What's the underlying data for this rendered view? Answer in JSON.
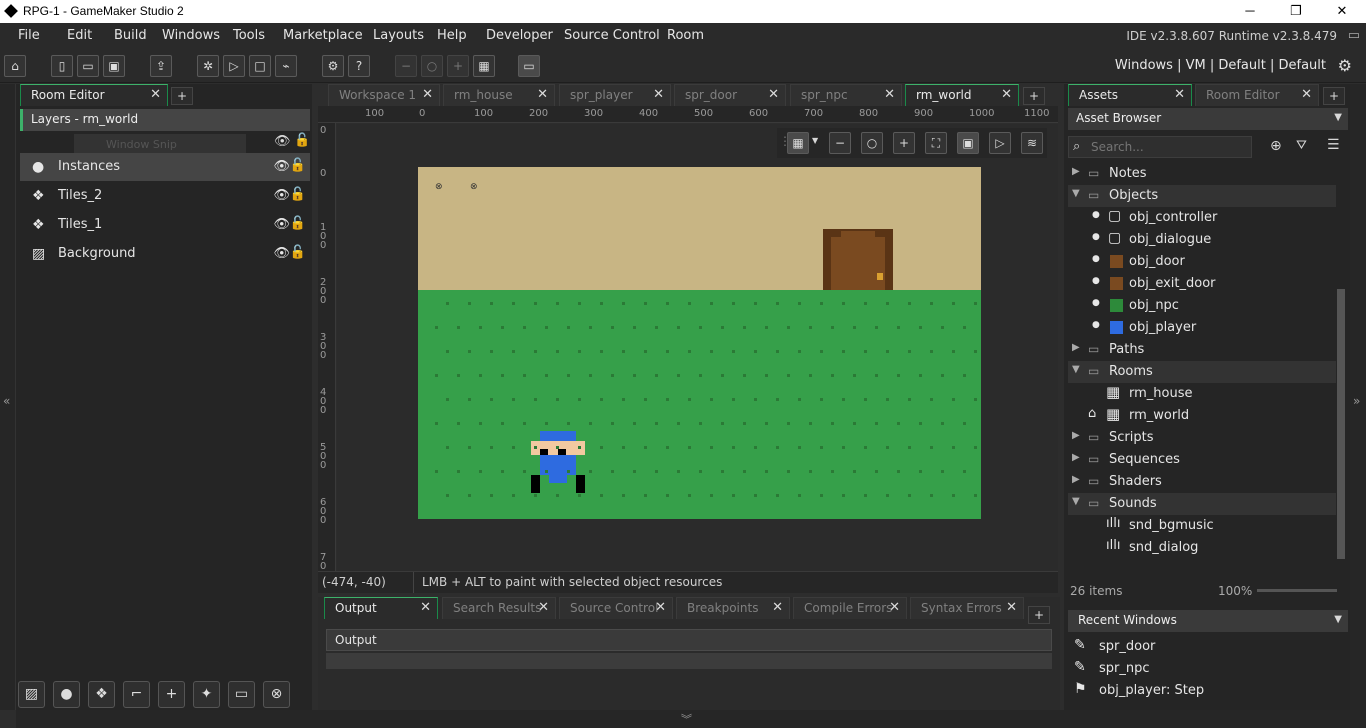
{
  "window": {
    "title": "RPG-1 - GameMaker Studio 2",
    "minimize": "─",
    "maximize": "❐",
    "close": "✕"
  },
  "menu": {
    "items": [
      "File",
      "Edit",
      "Build",
      "Windows",
      "Tools",
      "Marketplace",
      "Layouts",
      "Help",
      "Developer",
      "Source Control",
      "Room"
    ],
    "version": "IDE v2.3.8.607  Runtime v2.3.8.479"
  },
  "toolbar": {
    "target": "Windows | VM | Default | Default"
  },
  "left_panel": {
    "tab": "Room Editor",
    "layers_title": "Layers - rm_world",
    "ghost": "Window Snip",
    "layers": [
      {
        "name": "Instances",
        "icon": "instances-icon"
      },
      {
        "name": "Tiles_2",
        "icon": "tiles-icon"
      },
      {
        "name": "Tiles_1",
        "icon": "tiles-icon"
      },
      {
        "name": "Background",
        "icon": "background-icon"
      }
    ]
  },
  "center": {
    "tabs": [
      "Workspace 1",
      "rm_house",
      "spr_player",
      "spr_door",
      "spr_npc",
      "rm_world"
    ],
    "hruler": [
      "100",
      "0",
      "100",
      "200",
      "300",
      "400",
      "500",
      "600",
      "700",
      "800",
      "900",
      "1000",
      "1100"
    ],
    "vruler": [
      "0",
      "0",
      "1 0 0",
      "2 0 0",
      "3 0 0",
      "4 0 0",
      "5 0 0",
      "6 0 0",
      "7 0"
    ],
    "status": {
      "coords": "(-474, -40)",
      "hint": "LMB + ALT to paint with selected object resources"
    }
  },
  "output": {
    "tabs": [
      "Output",
      "Search Results",
      "Source Control",
      "Breakpoints",
      "Compile Errors",
      "Syntax Errors"
    ],
    "header": "Output"
  },
  "right_panel": {
    "tabs": [
      "Assets",
      "Room Editor"
    ],
    "browser": "Asset Browser",
    "search_placeholder": "Search...",
    "tree": [
      {
        "label": "Notes",
        "type": "folder",
        "open": false
      },
      {
        "label": "Objects",
        "type": "folder",
        "open": true
      },
      {
        "label": "obj_controller",
        "type": "object"
      },
      {
        "label": "obj_dialogue",
        "type": "object"
      },
      {
        "label": "obj_door",
        "type": "object"
      },
      {
        "label": "obj_exit_door",
        "type": "object"
      },
      {
        "label": "obj_npc",
        "type": "object"
      },
      {
        "label": "obj_player",
        "type": "object"
      },
      {
        "label": "Paths",
        "type": "folder",
        "open": false
      },
      {
        "label": "Rooms",
        "type": "folder",
        "open": true
      },
      {
        "label": "rm_house",
        "type": "room"
      },
      {
        "label": "rm_world",
        "type": "room"
      },
      {
        "label": "Scripts",
        "type": "folder",
        "open": false
      },
      {
        "label": "Sequences",
        "type": "folder",
        "open": false
      },
      {
        "label": "Shaders",
        "type": "folder",
        "open": false
      },
      {
        "label": "Sounds",
        "type": "folder",
        "open": true
      },
      {
        "label": "snd_bgmusic",
        "type": "sound"
      },
      {
        "label": "snd_dialog",
        "type": "sound"
      }
    ],
    "count": "26 items",
    "zoom": "100%",
    "recent_title": "Recent Windows",
    "recent": [
      "spr_door",
      "spr_npc",
      "obj_player: Step"
    ]
  },
  "colors": {
    "accent": "#3db26a",
    "sand": "#c8b584",
    "grass": "#36a04a",
    "door": "#6b3f1d"
  }
}
